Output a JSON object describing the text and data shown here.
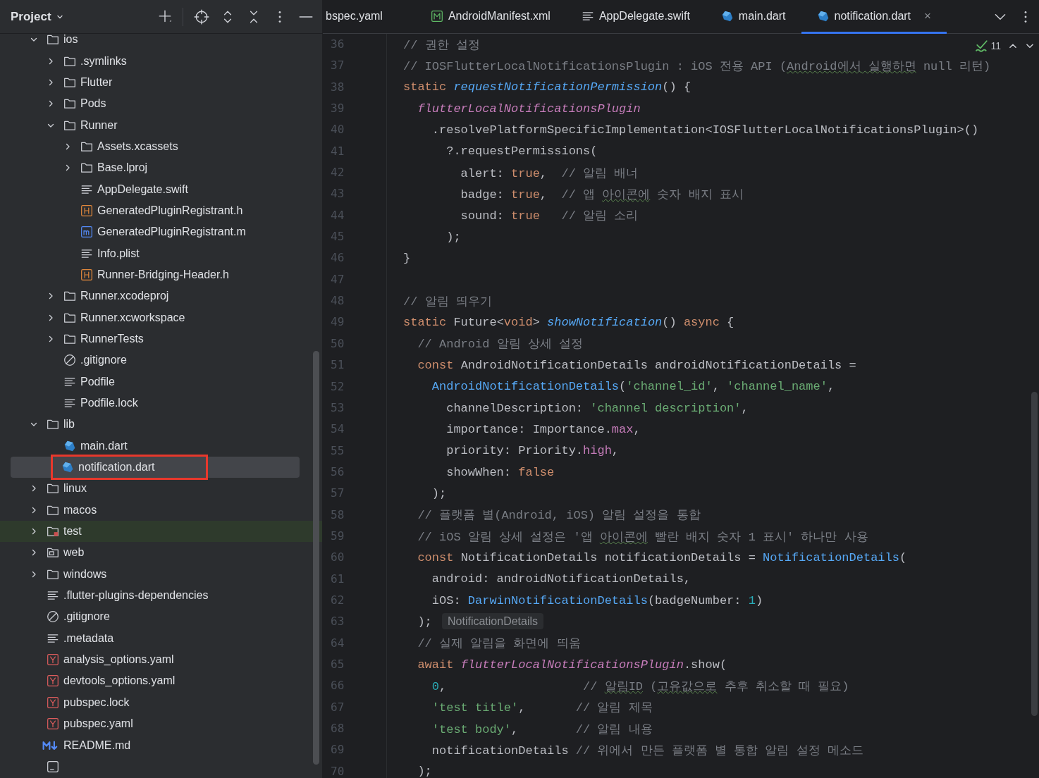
{
  "panel": {
    "title": "Project"
  },
  "tree": [
    {
      "label": "ios",
      "kind": "folder",
      "expanded": true,
      "selected": false,
      "children": [
        {
          "label": ".symlinks",
          "kind": "folder",
          "expanded": false,
          "selected": false
        },
        {
          "label": "Flutter",
          "kind": "folder",
          "expanded": false,
          "selected": false
        },
        {
          "label": "Pods",
          "kind": "folder",
          "expanded": false,
          "selected": false
        },
        {
          "label": "Runner",
          "kind": "folder",
          "expanded": true,
          "selected": false,
          "children": [
            {
              "label": "Assets.xcassets",
              "kind": "folder",
              "expanded": false,
              "selected": false
            },
            {
              "label": "Base.lproj",
              "kind": "folder",
              "expanded": false,
              "selected": false
            },
            {
              "label": "AppDelegate.swift",
              "kind": "lines",
              "selected": false
            },
            {
              "label": "GeneratedPluginRegistrant.h",
              "kind": "header",
              "selected": false
            },
            {
              "label": "GeneratedPluginRegistrant.m",
              "kind": "objc",
              "selected": false
            },
            {
              "label": "Info.plist",
              "kind": "lines",
              "selected": false
            },
            {
              "label": "Runner-Bridging-Header.h",
              "kind": "header",
              "selected": false
            }
          ]
        },
        {
          "label": "Runner.xcodeproj",
          "kind": "folder",
          "expanded": false,
          "selected": false
        },
        {
          "label": "Runner.xcworkspace",
          "kind": "folder",
          "expanded": false,
          "selected": false
        },
        {
          "label": "RunnerTests",
          "kind": "folder",
          "expanded": false,
          "selected": false
        },
        {
          "label": ".gitignore",
          "kind": "ignore",
          "selected": false
        },
        {
          "label": "Podfile",
          "kind": "lines",
          "selected": false
        },
        {
          "label": "Podfile.lock",
          "kind": "lines",
          "selected": false
        }
      ]
    },
    {
      "label": "lib",
      "kind": "folder",
      "expanded": true,
      "selected": false,
      "children": [
        {
          "label": "main.dart",
          "kind": "dart",
          "selected": false
        },
        {
          "label": "notification.dart",
          "kind": "dart",
          "selected": true
        }
      ]
    },
    {
      "label": "linux",
      "kind": "folder",
      "expanded": false,
      "selected": false
    },
    {
      "label": "macos",
      "kind": "folder",
      "expanded": false,
      "selected": false
    },
    {
      "label": "test",
      "kind": "test-folder",
      "expanded": false,
      "selected": false
    },
    {
      "label": "web",
      "kind": "web-folder",
      "expanded": false,
      "selected": false
    },
    {
      "label": "windows",
      "kind": "folder",
      "expanded": false,
      "selected": false
    },
    {
      "label": ".flutter-plugins-dependencies",
      "kind": "lines",
      "selected": false
    },
    {
      "label": ".gitignore",
      "kind": "ignore",
      "selected": false
    },
    {
      "label": ".metadata",
      "kind": "lines",
      "selected": false
    },
    {
      "label": "analysis_options.yaml",
      "kind": "yaml",
      "selected": false
    },
    {
      "label": "devtools_options.yaml",
      "kind": "yaml",
      "selected": false
    },
    {
      "label": "pubspec.lock",
      "kind": "yaml",
      "selected": false
    },
    {
      "label": "pubspec.yaml",
      "kind": "yaml",
      "selected": false
    },
    {
      "label": "README.md",
      "kind": "markdown",
      "selected": false
    },
    {
      "kind": "module",
      "selected": false
    }
  ],
  "tabs": [
    {
      "label": "bspec.yaml",
      "selected": false
    },
    {
      "label": "AndroidManifest.xml",
      "kind": "manifest",
      "selected": false
    },
    {
      "label": "AppDelegate.swift",
      "kind": "lines",
      "selected": false
    },
    {
      "label": "main.dart",
      "kind": "dart",
      "selected": false
    },
    {
      "label": "notification.dart",
      "kind": "dart",
      "selected": true,
      "close": "×"
    }
  ],
  "inspections": {
    "count": "11"
  },
  "lines": [
    {
      "number": "36",
      "tokens": [
        {
          "kind": "comment",
          "text": "// 권한 설정"
        }
      ]
    },
    {
      "number": "37",
      "tokens": [
        {
          "kind": "comment",
          "text": "// IOSFlutterLocalNotificationsPlugin : iOS 전용 API ("
        },
        {
          "kind": "typo",
          "text": "Android에서"
        },
        {
          "kind": "typo",
          "text": " 실행하면"
        },
        {
          "kind": "comment",
          "text": " null 리턴)"
        }
      ]
    },
    {
      "number": "38",
      "tokens": [
        {
          "kind": "keyword",
          "text": "static "
        },
        {
          "kind": "function",
          "text": "requestNotificationPermission"
        },
        {
          "kind": "plain",
          "text": "() {"
        }
      ]
    },
    {
      "number": "39",
      "tokens": [
        {
          "kind": "plugin",
          "text": "  flutterLocalNotificationsPlugin"
        }
      ]
    },
    {
      "number": "40",
      "tokens": [
        {
          "kind": "plain",
          "text": "    .resolvePlatformSpecificImplementation<IOSFlutterLocalNotificationsPlugin>()"
        }
      ]
    },
    {
      "number": "41",
      "tokens": [
        {
          "kind": "plain",
          "text": "      ?.requestPermissions("
        }
      ]
    },
    {
      "number": "42",
      "tokens": [
        {
          "kind": "plain",
          "text": "        alert: "
        },
        {
          "kind": "keyword",
          "text": "true"
        },
        {
          "kind": "plain",
          "text": ",  "
        },
        {
          "kind": "comment",
          "text": "// 알림 배너"
        }
      ]
    },
    {
      "number": "43",
      "tokens": [
        {
          "kind": "plain",
          "text": "        badge: "
        },
        {
          "kind": "keyword",
          "text": "true"
        },
        {
          "kind": "plain",
          "text": ",  "
        },
        {
          "kind": "comment",
          "text": "// 앱 "
        },
        {
          "kind": "typo",
          "text": "아이콘에"
        },
        {
          "kind": "comment",
          "text": " 숫자 배지 표시"
        }
      ]
    },
    {
      "number": "44",
      "tokens": [
        {
          "kind": "plain",
          "text": "        sound: "
        },
        {
          "kind": "keyword",
          "text": "true"
        },
        {
          "kind": "comment",
          "text": "   // 알림 소리"
        }
      ]
    },
    {
      "number": "45",
      "tokens": [
        {
          "kind": "plain",
          "text": "      );"
        }
      ]
    },
    {
      "number": "46",
      "tokens": [
        {
          "kind": "plain",
          "text": "}"
        }
      ]
    },
    {
      "number": "47"
    },
    {
      "number": "48",
      "tokens": [
        {
          "kind": "comment",
          "text": "// 알림 띄우기"
        }
      ]
    },
    {
      "number": "49",
      "tokens": [
        {
          "kind": "keyword",
          "text": "static "
        },
        {
          "kind": "plain",
          "text": "Future<"
        },
        {
          "kind": "keyword",
          "text": "void"
        },
        {
          "kind": "plain",
          "text": "> "
        },
        {
          "kind": "function",
          "text": "showNotification"
        },
        {
          "kind": "plain",
          "text": "() "
        },
        {
          "kind": "keyword",
          "text": "async"
        },
        {
          "kind": "plain",
          "text": " {"
        }
      ]
    },
    {
      "number": "50",
      "tokens": [
        {
          "kind": "comment",
          "text": "  // Android 알림 상세 설정"
        }
      ]
    },
    {
      "number": "51",
      "tokens": [
        {
          "kind": "keyword",
          "text": "  const "
        },
        {
          "kind": "plain",
          "text": "AndroidNotificationDetails androidNotificationDetails ="
        }
      ]
    },
    {
      "number": "52",
      "tokens": [
        {
          "kind": "constructor",
          "text": "    AndroidNotificationDetails"
        },
        {
          "kind": "plain",
          "text": "("
        },
        {
          "kind": "string",
          "text": "'channel_id'"
        },
        {
          "kind": "plain",
          "text": ", "
        },
        {
          "kind": "string",
          "text": "'channel_name'"
        },
        {
          "kind": "plain",
          "text": ","
        }
      ]
    },
    {
      "number": "53",
      "tokens": [
        {
          "kind": "plain",
          "text": "      channelDescription: "
        },
        {
          "kind": "string",
          "text": "'channel description'"
        },
        {
          "kind": "plain",
          "text": ","
        }
      ]
    },
    {
      "number": "54",
      "tokens": [
        {
          "kind": "plain",
          "text": "      importance: Importance."
        },
        {
          "kind": "field",
          "text": "max"
        },
        {
          "kind": "plain",
          "text": ","
        }
      ]
    },
    {
      "number": "55",
      "tokens": [
        {
          "kind": "plain",
          "text": "      priority: Priority."
        },
        {
          "kind": "field",
          "text": "high"
        },
        {
          "kind": "plain",
          "text": ","
        }
      ]
    },
    {
      "number": "56",
      "tokens": [
        {
          "kind": "plain",
          "text": "      showWhen: "
        },
        {
          "kind": "keyword",
          "text": "false"
        }
      ]
    },
    {
      "number": "57",
      "tokens": [
        {
          "kind": "plain",
          "text": "    );"
        }
      ]
    },
    {
      "number": "58",
      "tokens": [
        {
          "kind": "comment",
          "text": "  // 플랫폼 별(Android, iOS) 알림 설정을 통합"
        }
      ]
    },
    {
      "number": "59",
      "tokens": [
        {
          "kind": "comment",
          "text": "  // iOS 알림 상세 설정은 '앱 "
        },
        {
          "kind": "typo",
          "text": "아이콘에"
        },
        {
          "kind": "comment",
          "text": " 빨란 배지 숫자 1 표시' 하나만 사용"
        }
      ]
    },
    {
      "number": "60",
      "tokens": [
        {
          "kind": "keyword",
          "text": "  const "
        },
        {
          "kind": "plain",
          "text": "NotificationDetails notificationDetails = "
        },
        {
          "kind": "constructor",
          "text": "NotificationDetails"
        },
        {
          "kind": "plain",
          "text": "("
        }
      ]
    },
    {
      "number": "61",
      "tokens": [
        {
          "kind": "plain",
          "text": "    android: androidNotificationDetails,"
        }
      ]
    },
    {
      "number": "62",
      "tokens": [
        {
          "kind": "plain",
          "text": "    iOS: "
        },
        {
          "kind": "constructor",
          "text": "DarwinNotificationDetails"
        },
        {
          "kind": "plain",
          "text": "(badgeNumber: "
        },
        {
          "kind": "number",
          "text": "1"
        },
        {
          "kind": "plain",
          "text": ")"
        }
      ]
    },
    {
      "number": "63",
      "tokens": [
        {
          "kind": "plain",
          "text": "  ); "
        },
        {
          "kind": "hint",
          "text": "NotificationDetails"
        }
      ]
    },
    {
      "number": "64",
      "tokens": [
        {
          "kind": "comment",
          "text": "  // 실제 알림을 화면에 띄움"
        }
      ]
    },
    {
      "number": "65",
      "tokens": [
        {
          "kind": "keyword",
          "text": "  await "
        },
        {
          "kind": "plugin",
          "text": "flutterLocalNotificationsPlugin"
        },
        {
          "kind": "plain",
          "text": ".show("
        }
      ]
    },
    {
      "number": "66",
      "tokens": [
        {
          "kind": "number",
          "text": "    0"
        },
        {
          "kind": "plain",
          "text": ","
        },
        {
          "kind": "comment",
          "text": "                   // "
        },
        {
          "kind": "typo",
          "text": "알림ID"
        },
        {
          "kind": "comment",
          "text": " ("
        },
        {
          "kind": "typo",
          "text": "고유값으로"
        },
        {
          "kind": "comment",
          "text": " 추후 취소할 때 필요)"
        }
      ]
    },
    {
      "number": "67",
      "tokens": [
        {
          "kind": "string",
          "text": "    'test title'"
        },
        {
          "kind": "plain",
          "text": ","
        },
        {
          "kind": "comment",
          "text": "       // 알림 제목"
        }
      ]
    },
    {
      "number": "68",
      "tokens": [
        {
          "kind": "string",
          "text": "    'test body'"
        },
        {
          "kind": "plain",
          "text": ","
        },
        {
          "kind": "comment",
          "text": "        // 알림 내용"
        }
      ]
    },
    {
      "number": "69",
      "tokens": [
        {
          "kind": "plain",
          "text": "    notificationDetails "
        },
        {
          "kind": "comment",
          "text": "// 위에서 만든 플랫폼 별 통합 알림 설정 메소드"
        }
      ]
    },
    {
      "number": "70",
      "tokens": [
        {
          "kind": "plain",
          "text": "  );"
        }
      ]
    }
  ]
}
